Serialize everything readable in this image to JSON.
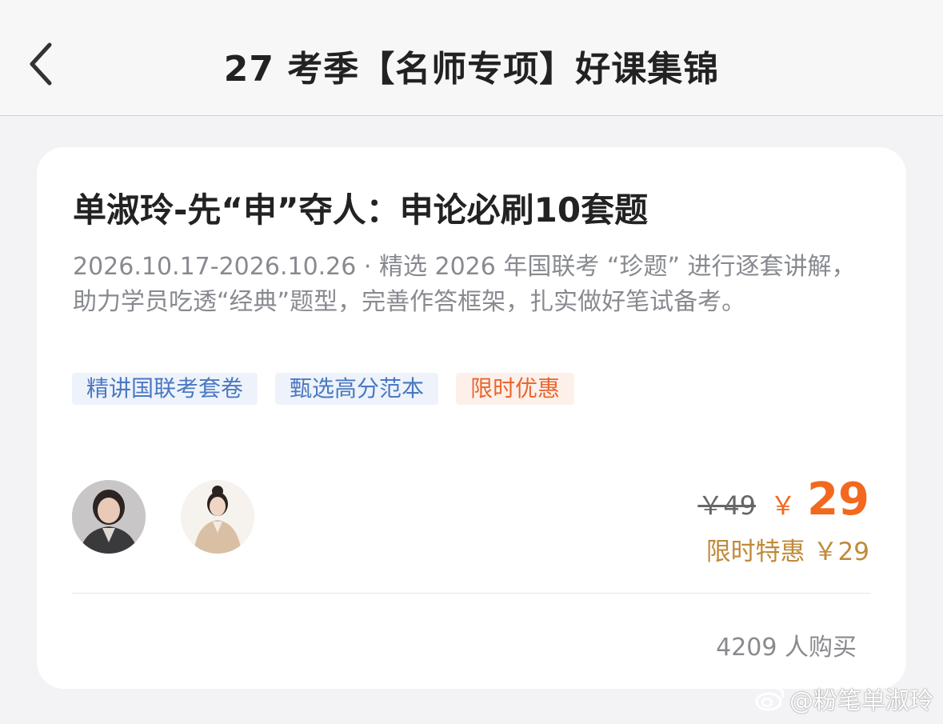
{
  "header": {
    "title": "27 考季【名师专项】好课集锦"
  },
  "course": {
    "title": "单淑玲-先“申”夺人：申论必刷10套题",
    "description": "2026.10.17-2026.10.26 · 精选 2026 年国联考 “珍题” 进行逐套讲解，助力学员吃透“经典”题型，完善作答框架，扎实做好笔试备考。",
    "tags": [
      "精讲国联考套卷",
      "甄选高分范本",
      "限时优惠"
    ],
    "original_price": "￥49",
    "currency_symbol": "￥",
    "price": "29",
    "promo_text": "限时特惠 ￥29",
    "buyers": "4209 人购买"
  },
  "watermark": {
    "text": "@粉笔单淑玲"
  },
  "colors": {
    "accent_orange": "#f2691e",
    "promo_gold": "#c08a3a",
    "tag_blue": "#4a78c2",
    "tag_red": "#e8672f"
  }
}
